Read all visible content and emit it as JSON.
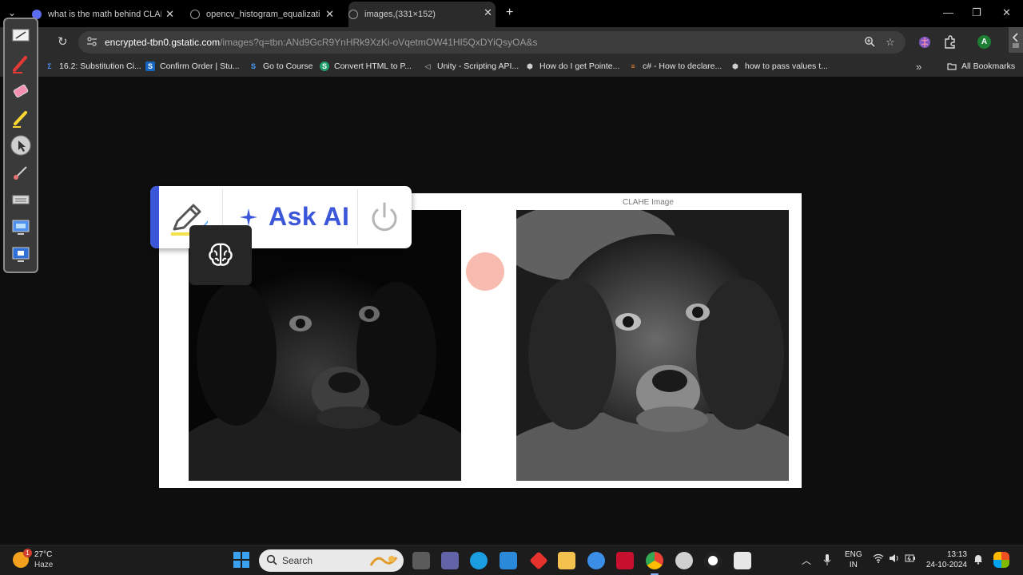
{
  "browser": {
    "tabs": [
      {
        "title": "what is the math behind CLAHE",
        "active": false,
        "favicon": "ai-star-icon",
        "favicon_color": "#5b6cf0"
      },
      {
        "title": "opencv_histogram_equalization",
        "active": false,
        "favicon": "globe-icon",
        "favicon_color": "#8a8a8a"
      },
      {
        "title": "images,(331×152)",
        "active": true,
        "favicon": "globe-icon",
        "favicon_color": "#8a8a8a"
      }
    ],
    "new_tab": "+",
    "window": {
      "minimize": "—",
      "restore": "❐",
      "close": "✕"
    },
    "address": {
      "host": "encrypted-tbn0.gstatic.com",
      "path": "/images?q=tbn:ANd9GcR9YnHRk9XzKi-oVqetmOW41HI5QxDYiQsyOA&s"
    },
    "profile_initial": "A",
    "bookmarks": [
      {
        "label": "16.2: Substitution Ci...",
        "icon": "sigma-icon",
        "color": "#3b82f6",
        "glyph": "Σ"
      },
      {
        "label": "Confirm Order | Stu...",
        "icon": "bookmark-doc-icon",
        "color": "#1565c0",
        "glyph": "S"
      },
      {
        "label": "Go to Course",
        "icon": "dollar-icon",
        "color": "#1e88e5",
        "glyph": "S"
      },
      {
        "label": "Convert HTML to P...",
        "icon": "convert-icon",
        "color": "#22a06b",
        "glyph": "S"
      },
      {
        "label": "Unity - Scripting API...",
        "icon": "unity-icon",
        "color": "#9e9e9e",
        "glyph": "◁"
      },
      {
        "label": "How do I get Pointe...",
        "icon": "unity-logo-icon",
        "color": "#9e9e9e",
        "glyph": "⬢"
      },
      {
        "label": "c# - How to declare...",
        "icon": "stackoverflow-icon",
        "color": "#f48024",
        "glyph": "≡"
      },
      {
        "label": "how to pass values t...",
        "icon": "unity-logo-icon",
        "color": "#9e9e9e",
        "glyph": "⬢"
      }
    ],
    "bookmarks_more": "»",
    "all_bookmarks": "All Bookmarks"
  },
  "content": {
    "right_image_title": "CLAHE Image"
  },
  "askai_widget": {
    "label": "Ask AI",
    "accent_color": "#3b56d9"
  },
  "taskbar": {
    "weather": {
      "temp": "27°C",
      "condition": "Haze",
      "badge": "1"
    },
    "search_placeholder": "Search",
    "language": {
      "line1": "ENG",
      "line2": "IN"
    },
    "clock": {
      "time": "13:13",
      "date": "24-10-2024"
    },
    "apps": [
      {
        "name": "file-explorer-dark-icon",
        "color": "#5b5b5b"
      },
      {
        "name": "teams-icon",
        "color": "#6264a7"
      },
      {
        "name": "edge-icon",
        "color": "#1b9de2"
      },
      {
        "name": "store-icon",
        "color": "#2b89d9"
      },
      {
        "name": "diamond-app-icon",
        "color": "#e5322d"
      },
      {
        "name": "folder-icon",
        "color": "#f2c14e"
      },
      {
        "name": "python-icon",
        "color": "#3a8ee6"
      },
      {
        "name": "mcafee-icon",
        "color": "#c8102e"
      },
      {
        "name": "chrome-icon",
        "color": "#34a853"
      },
      {
        "name": "clock-app-icon",
        "color": "#d0d0d0"
      },
      {
        "name": "record-icon",
        "color": "#e0242a"
      },
      {
        "name": "snipping-icon",
        "color": "#e7e7e7"
      }
    ]
  }
}
